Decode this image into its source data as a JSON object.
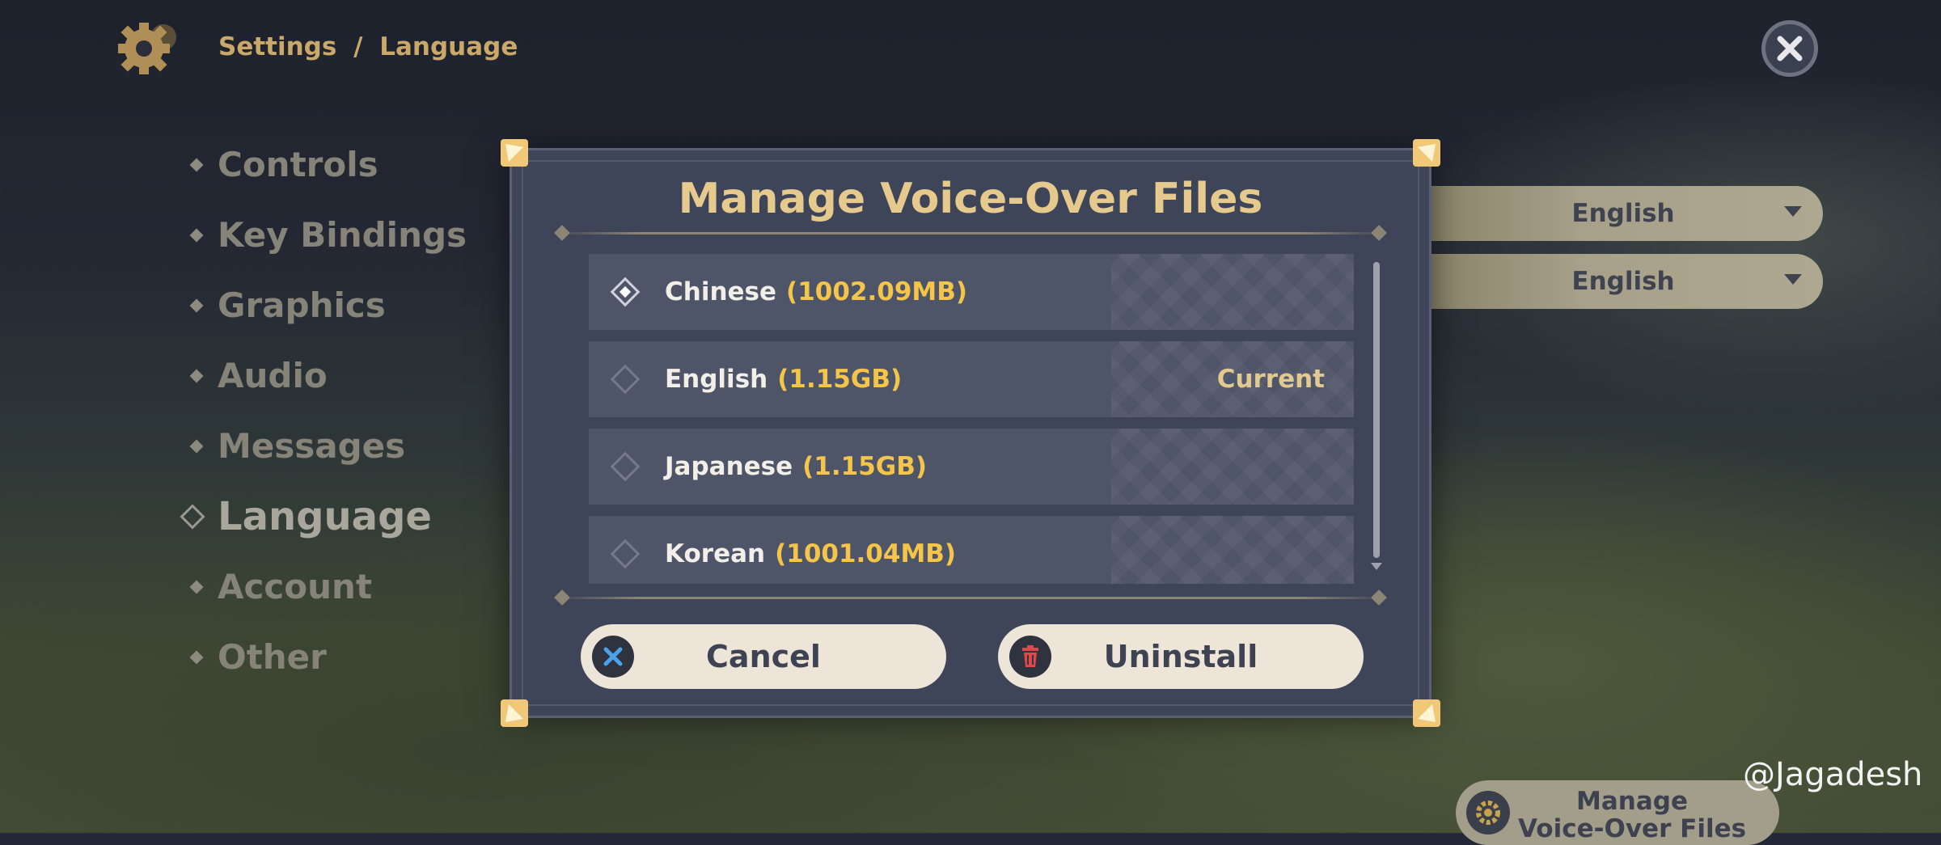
{
  "breadcrumb": {
    "section": "Settings",
    "separator": "/",
    "page": "Language"
  },
  "sidebar": {
    "items": [
      {
        "label": "Controls"
      },
      {
        "label": "Key Bindings"
      },
      {
        "label": "Graphics"
      },
      {
        "label": "Audio"
      },
      {
        "label": "Messages"
      },
      {
        "label": "Language"
      },
      {
        "label": "Account"
      },
      {
        "label": "Other"
      }
    ],
    "active_index": 5
  },
  "language_dropdowns": [
    {
      "value": "English"
    },
    {
      "value": "English"
    }
  ],
  "bottom_button": {
    "label_line1": "Manage",
    "label_line2": "Voice-Over Files"
  },
  "watermark": "@Jagadesh",
  "dialog": {
    "title": "Manage Voice-Over Files",
    "files": [
      {
        "name": "Chinese",
        "size": "(1002.09MB)",
        "status": "",
        "selected": true
      },
      {
        "name": "English",
        "size": "(1.15GB)",
        "status": "Current",
        "selected": false
      },
      {
        "name": "Japanese",
        "size": "(1.15GB)",
        "status": "",
        "selected": false
      },
      {
        "name": "Korean",
        "size": "(1001.04MB)",
        "status": "",
        "selected": false
      }
    ],
    "cancel_label": "Cancel",
    "uninstall_label": "Uninstall"
  },
  "colors": {
    "accent_gold": "#e6c98c",
    "size_yellow": "#f5c54a",
    "cancel_icon": "#4aa3e8",
    "uninstall_icon": "#e04848"
  },
  "icons": [
    "gear-icon",
    "close-icon",
    "cancel-x-icon",
    "trash-icon"
  ]
}
